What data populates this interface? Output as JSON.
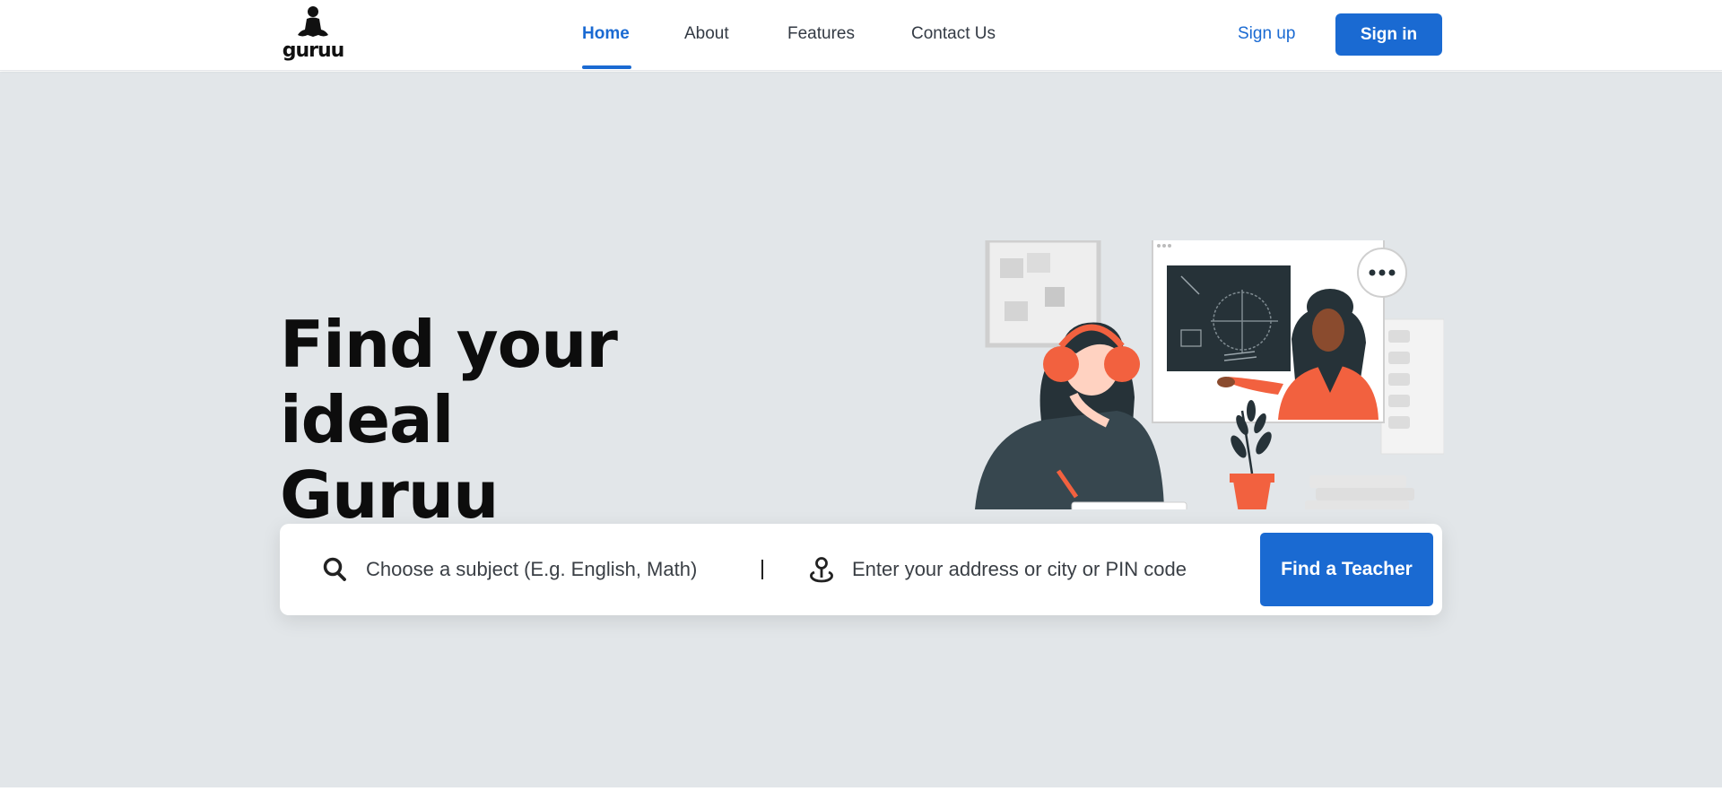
{
  "header": {
    "logo_text": "guruu",
    "nav": [
      {
        "label": "Home",
        "active": true
      },
      {
        "label": "About",
        "active": false
      },
      {
        "label": "Features",
        "active": false
      },
      {
        "label": "Contact Us",
        "active": false
      }
    ],
    "signup_label": "Sign up",
    "signin_label": "Sign in"
  },
  "hero": {
    "headline_line1": "Find your ideal",
    "headline_line2": "Guruu",
    "illustration_icon": "online-tutoring-illustration"
  },
  "search": {
    "subject_placeholder": "Choose a subject (E.g. English, Math)",
    "address_placeholder": "Enter your address or city or PIN code",
    "find_button_label": "Find a Teacher"
  },
  "colors": {
    "accent": "#1a6ad2",
    "hero_bg": "#e2e6e9",
    "illustration_orange": "#f2613f",
    "illustration_dark": "#263238"
  }
}
